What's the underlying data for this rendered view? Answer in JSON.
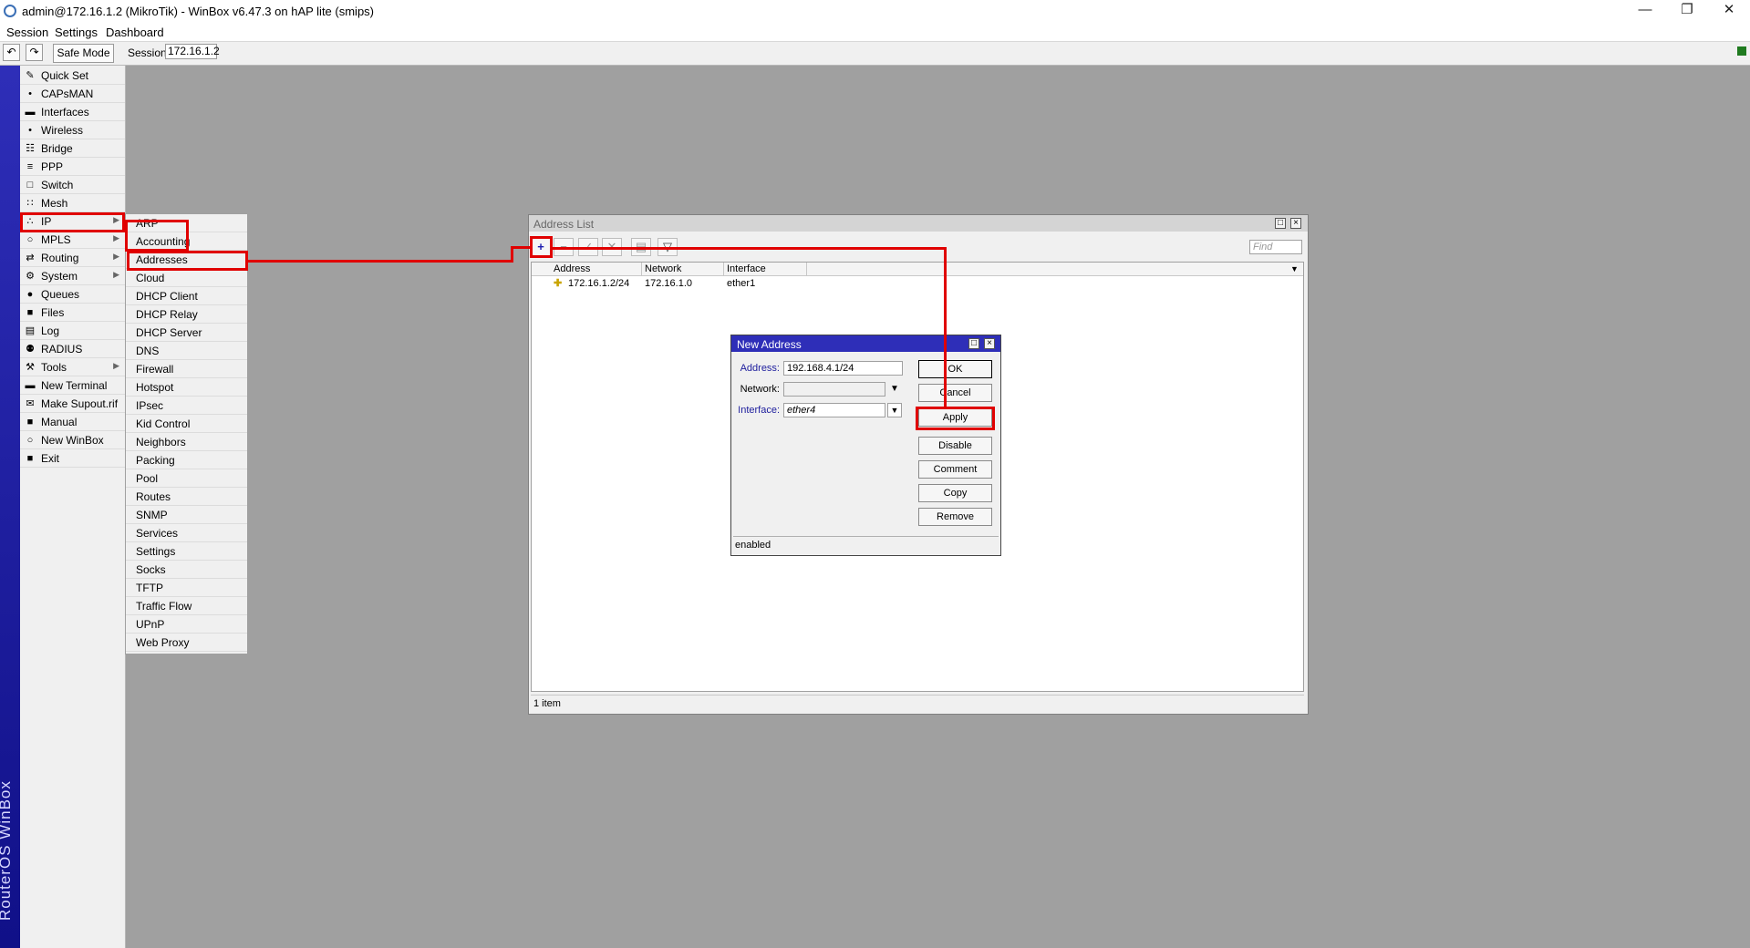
{
  "window": {
    "title": "admin@172.16.1.2 (MikroTik) - WinBox v6.47.3 on hAP lite (smips)",
    "controls": [
      "—",
      "❐",
      "✕"
    ]
  },
  "menubar": [
    "Session",
    "Settings",
    "Dashboard"
  ],
  "toolbar": {
    "undo_icon": "↶",
    "redo_icon": "↷",
    "safe_mode": "Safe Mode",
    "session_label": "Session:",
    "session_value": "172.16.1.2"
  },
  "brand": "RouterOS WinBox",
  "left_menu": [
    {
      "label": "Quick Set",
      "icon": "✎"
    },
    {
      "label": "CAPsMAN",
      "icon": "•"
    },
    {
      "label": "Interfaces",
      "icon": "▬"
    },
    {
      "label": "Wireless",
      "icon": "•"
    },
    {
      "label": "Bridge",
      "icon": "☷"
    },
    {
      "label": "PPP",
      "icon": "≡"
    },
    {
      "label": "Switch",
      "icon": "□"
    },
    {
      "label": "Mesh",
      "icon": "∷"
    },
    {
      "label": "IP",
      "icon": "∴"
    },
    {
      "label": "MPLS",
      "icon": "○"
    },
    {
      "label": "Routing",
      "icon": "⇄"
    },
    {
      "label": "System",
      "icon": "⚙"
    },
    {
      "label": "Queues",
      "icon": "●"
    },
    {
      "label": "Files",
      "icon": "■"
    },
    {
      "label": "Log",
      "icon": "▤"
    },
    {
      "label": "RADIUS",
      "icon": "⚉"
    },
    {
      "label": "Tools",
      "icon": "⚒"
    },
    {
      "label": "New Terminal",
      "icon": "▬"
    },
    {
      "label": "Make Supout.rif",
      "icon": "✉"
    },
    {
      "label": "Manual",
      "icon": "■"
    },
    {
      "label": "New WinBox",
      "icon": "○"
    },
    {
      "label": "Exit",
      "icon": "■"
    }
  ],
  "submenu_arrow": "▶",
  "ip_submenu": [
    "ARP",
    "Accounting",
    "Addresses",
    "Cloud",
    "DHCP Client",
    "DHCP Relay",
    "DHCP Server",
    "DNS",
    "Firewall",
    "Hotspot",
    "IPsec",
    "Kid Control",
    "Neighbors",
    "Packing",
    "Pool",
    "Routes",
    "SNMP",
    "Services",
    "Settings",
    "Socks",
    "TFTP",
    "Traffic Flow",
    "UPnP",
    "Web Proxy"
  ],
  "address_list": {
    "title": "Address List",
    "find_placeholder": "Find",
    "toolbar_icons": {
      "add": "+",
      "remove": "−",
      "enable": "✓",
      "disable": "✕",
      "comment": "▤",
      "filter": "▽"
    },
    "columns": [
      "Address",
      "Network",
      "Interface"
    ],
    "rows": [
      {
        "address": "172.16.1.2/24",
        "network": "172.16.1.0",
        "interface": "ether1"
      }
    ],
    "status": "1 item"
  },
  "new_address": {
    "title": "New Address",
    "address_label": "Address:",
    "address_value": "192.168.4.1/24",
    "network_label": "Network:",
    "network_value": "",
    "interface_label": "Interface:",
    "interface_value": "ether4",
    "buttons": [
      "OK",
      "Cancel",
      "Apply",
      "Disable",
      "Comment",
      "Copy",
      "Remove"
    ],
    "status": "enabled"
  },
  "colors": {
    "highlight": "#e00000",
    "dialog_title": "#2e2eb8",
    "desktop": "#a0a0a0"
  }
}
